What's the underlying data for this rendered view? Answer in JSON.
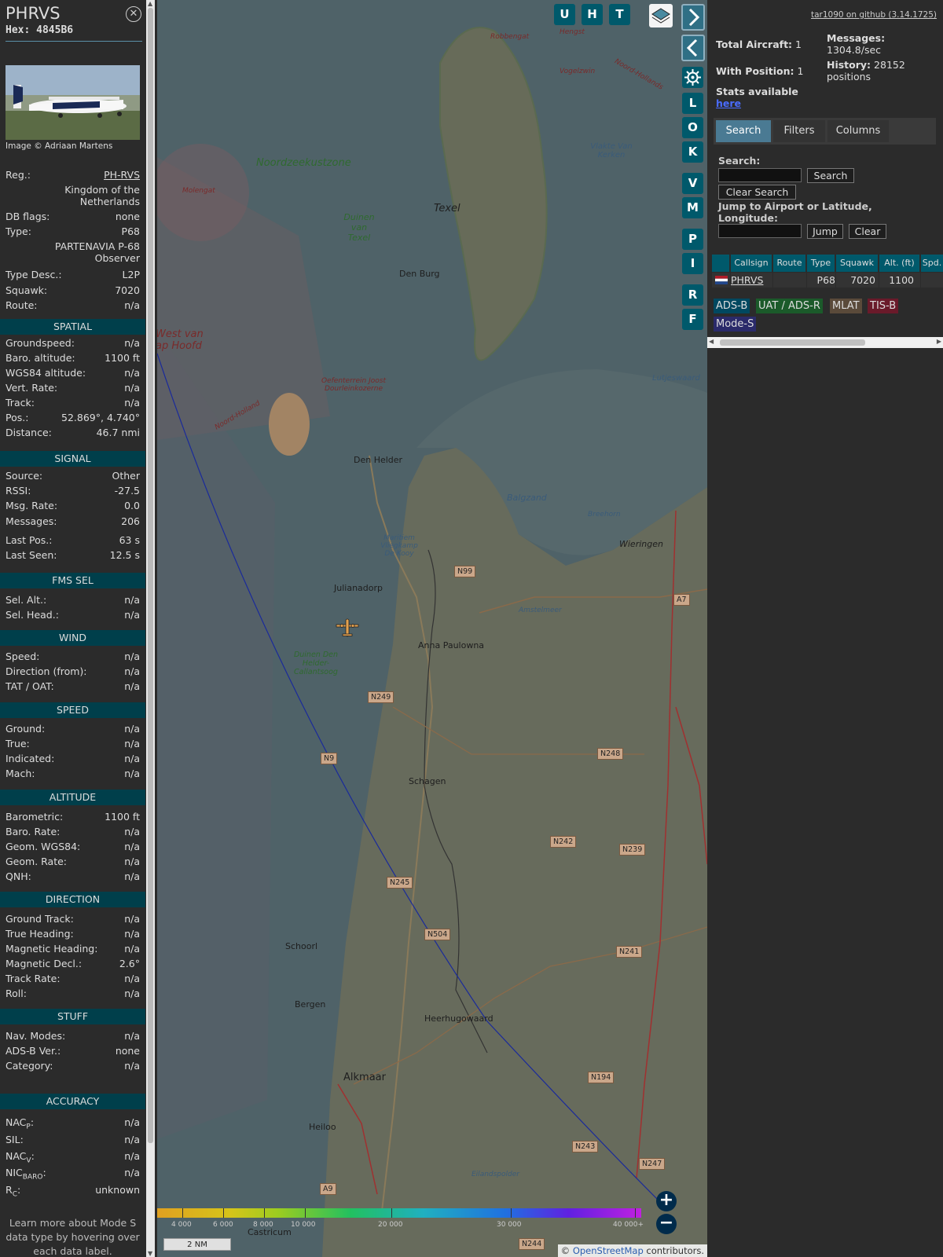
{
  "aircraft": {
    "callsign": "PHRVS",
    "hex_label": "Hex:",
    "hex": "4845B6",
    "photo_credit": "Image © Adriaan Martens",
    "reg_label": "Reg.:",
    "reg": "PH-RVS",
    "country": "Kingdom of the Netherlands",
    "dbflags_label": "DB flags:",
    "dbflags": "none",
    "type_label": "Type:",
    "type": "P68",
    "type_full": "PARTENAVIA P-68 Observer",
    "typedesc_label": "Type Desc.:",
    "typedesc": "L2P",
    "squawk_label": "Squawk:",
    "squawk": "7020",
    "route_label": "Route:",
    "route": "n/a"
  },
  "sections": {
    "spatial": "SPATIAL",
    "signal": "SIGNAL",
    "fms": "FMS SEL",
    "wind": "WIND",
    "speed": "SPEED",
    "altitude": "ALTITUDE",
    "direction": "DIRECTION",
    "stuff": "STUFF",
    "accuracy": "ACCURACY"
  },
  "spatial": [
    {
      "k": "Groundspeed:",
      "v": "n/a"
    },
    {
      "k": "Baro. altitude:",
      "v": "1100 ft"
    },
    {
      "k": "WGS84 altitude:",
      "v": "n/a"
    },
    {
      "k": "Vert. Rate:",
      "v": "n/a"
    },
    {
      "k": "Track:",
      "v": "n/a"
    },
    {
      "k": "Pos.:",
      "v": "52.869°, 4.740°"
    },
    {
      "k": "Distance:",
      "v": "46.7 nmi"
    }
  ],
  "signal": [
    {
      "k": "Source:",
      "v": "Other"
    },
    {
      "k": "RSSI:",
      "v": "-27.5"
    },
    {
      "k": "Msg. Rate:",
      "v": "0.0"
    },
    {
      "k": "Messages:",
      "v": "206"
    },
    {
      "k": "Last Pos.:",
      "v": "63 s"
    },
    {
      "k": "Last Seen:",
      "v": "12.5 s"
    }
  ],
  "fms": [
    {
      "k": "Sel. Alt.:",
      "v": "n/a"
    },
    {
      "k": "Sel. Head.:",
      "v": "n/a"
    }
  ],
  "wind": [
    {
      "k": "Speed:",
      "v": "n/a"
    },
    {
      "k": "Direction (from):",
      "v": "n/a"
    },
    {
      "k": "TAT / OAT:",
      "v": "n/a"
    }
  ],
  "speed": [
    {
      "k": "Ground:",
      "v": "n/a"
    },
    {
      "k": "True:",
      "v": "n/a"
    },
    {
      "k": "Indicated:",
      "v": "n/a"
    },
    {
      "k": "Mach:",
      "v": "n/a"
    }
  ],
  "altitude": [
    {
      "k": "Barometric:",
      "v": "1100 ft"
    },
    {
      "k": "Baro. Rate:",
      "v": "n/a"
    },
    {
      "k": "Geom. WGS84:",
      "v": "n/a"
    },
    {
      "k": "Geom. Rate:",
      "v": "n/a"
    },
    {
      "k": "QNH:",
      "v": "n/a"
    }
  ],
  "direction": [
    {
      "k": "Ground Track:",
      "v": "n/a"
    },
    {
      "k": "True Heading:",
      "v": "n/a"
    },
    {
      "k": "Magnetic Heading:",
      "v": "n/a"
    },
    {
      "k": "Magnetic Decl.:",
      "v": "2.6°"
    },
    {
      "k": "Track Rate:",
      "v": "n/a"
    },
    {
      "k": "Roll:",
      "v": "n/a"
    }
  ],
  "stuff": [
    {
      "k": "Nav. Modes:",
      "v": "n/a"
    },
    {
      "k": "ADS-B Ver.:",
      "v": "none"
    },
    {
      "k": "Category:",
      "v": "n/a"
    }
  ],
  "accuracy": {
    "nacp_k": "NAC",
    "nacp_sub": "P",
    "nacp_v": "n/a",
    "sil_k": "SIL:",
    "sil_v": "n/a",
    "nacv_k": "NAC",
    "nacv_sub": "V",
    "nacv_v": "n/a",
    "nicbaro_k": "NIC",
    "nicbaro_sub": "BARO",
    "nicbaro_v": "n/a",
    "rc_k": "R",
    "rc_sub": "C",
    "rc_v": "unknown"
  },
  "learn_more": "Learn more about Mode S data type by hovering over each data label.",
  "map": {
    "labels": {
      "noordzeekustzone": "Noordzeekustzone",
      "texel": "Texel",
      "duinen_texel": "Duinen van Texel",
      "den_burg": "Den Burg",
      "den_helder": "Den Helder",
      "julianadorp": "Julianadorp",
      "anna_paulowna": "Anna Paulowna",
      "schagen": "Schagen",
      "schoorl": "Schoorl",
      "bergen": "Bergen",
      "heerhugowaard": "Heerhugowaard",
      "alkmaar": "Alkmaar",
      "heiloo": "Heiloo",
      "castricum": "Castricum",
      "wieringen": "Wieringen",
      "balgzand": "Balgzand",
      "breehorn": "Breehorn",
      "vlakte_van_kerken": "Vlakte Van Kerken",
      "lutjeswaard": "Lutjeswaard",
      "amstelmeer": "Amstelmeer",
      "eilandspolder": "Eilandspolder",
      "molengat": "Molengat",
      "west_van_hoofd": "West van ap Hoofd",
      "oefenterrein": "Oefenterrein Joost Dourleinkozerne",
      "maritiem": "Maritiem Vliegkamp De Kooy",
      "duinen_den_helder": "Duinen Den Helder-Callantsoog",
      "noord_holland": "Noord-Holland",
      "robbengat": "Robbengat",
      "hengst": "Hengst",
      "vogelzwin": "Vogelzwin",
      "noord_hollands": "Noord-Hollands"
    },
    "roads": [
      "N99",
      "N249",
      "N9",
      "N248",
      "N242",
      "N239",
      "N245",
      "N504",
      "N241",
      "N194",
      "N243",
      "N247",
      "A9",
      "N244",
      "A7"
    ],
    "buttons": [
      "U",
      "H",
      "T"
    ],
    "side_buttons": [
      "L",
      "O",
      "K",
      "V",
      "M",
      "P",
      "I",
      "R",
      "F"
    ],
    "colorbar_ticks": [
      "4 000",
      "6 000",
      "8 000",
      "10 000",
      "20 000",
      "30 000",
      "40 000+"
    ],
    "scale": "2 NM",
    "attribution_prefix": "© ",
    "attribution_link": "OpenStreetMap",
    "attribution_suffix": " contributors."
  },
  "right": {
    "github": "tar1090 on github (3.14.1725)",
    "total_aircraft_label": "Total Aircraft:",
    "total_aircraft": "1",
    "with_position_label": "With Position:",
    "with_position": "1",
    "messages_label": "Messages:",
    "messages": "1304.8/sec",
    "history_label": "History:",
    "history": "28152 positions",
    "stats_label": "Stats available",
    "stats_link": "here",
    "tabs": [
      "Search",
      "Filters",
      "Columns"
    ],
    "search_label": "Search:",
    "search_button": "Search",
    "clear_search": "Clear Search",
    "jump_label": "Jump to Airport or Latitude, Longitude:",
    "jump_button": "Jump",
    "clear_button": "Clear",
    "table_headers": [
      "Callsign",
      "Route",
      "Type",
      "Squawk",
      "Alt. (ft)",
      "Spd."
    ],
    "table_row": {
      "callsign": "PHRVS",
      "route": "",
      "type": "P68",
      "squawk": "7020",
      "alt": "1100",
      "spd": ""
    },
    "legend": [
      "ADS-B",
      "UAT / ADS-R",
      "MLAT",
      "TIS-B",
      "Mode-S"
    ]
  }
}
